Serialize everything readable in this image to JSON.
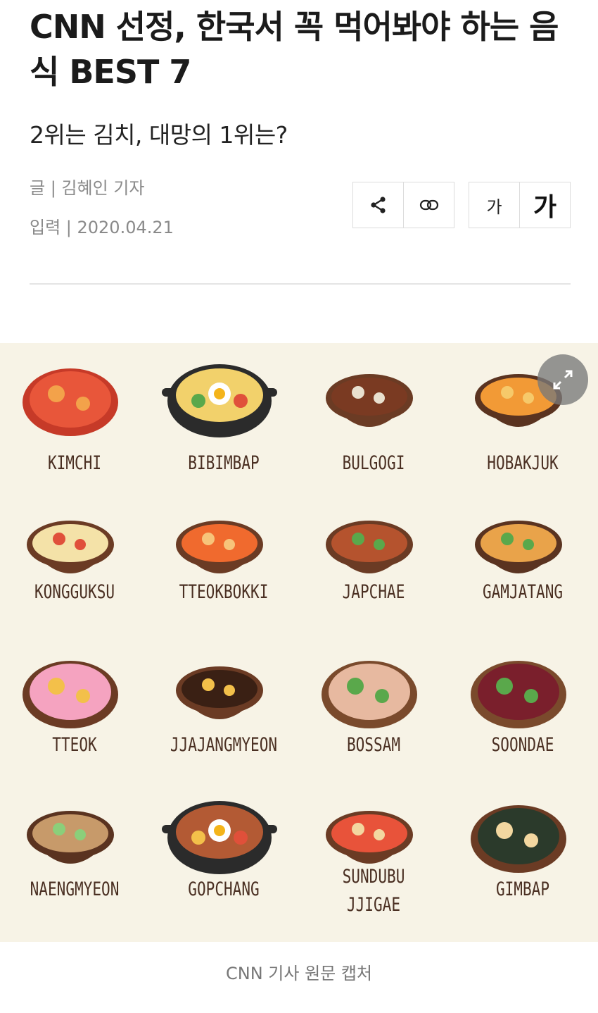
{
  "article": {
    "title": "CNN 선정, 한국서 꼭 먹어봐야 하는 음식 BEST 7",
    "subtitle": "2위는 김치, 대망의 1위는?",
    "author": "글 | 김혜인 기자",
    "date": "입력 | 2020.04.21"
  },
  "toolbar": {
    "share_icon": "share-icon",
    "link_icon": "link-icon",
    "font_small_label": "가",
    "font_large_label": "가"
  },
  "figure": {
    "expand_icon": "expand-icon",
    "caption": "CNN 기사 원문 캡처",
    "foods": [
      {
        "label": "KIMCHI",
        "line2": ""
      },
      {
        "label": "BIBIMBAP",
        "line2": ""
      },
      {
        "label": "BULGOGI",
        "line2": ""
      },
      {
        "label": "HOBAKJUK",
        "line2": ""
      },
      {
        "label": "KONGGUKSU",
        "line2": ""
      },
      {
        "label": "TTEOKBOKKI",
        "line2": ""
      },
      {
        "label": "JAPCHAE",
        "line2": ""
      },
      {
        "label": "GAMJATANG",
        "line2": ""
      },
      {
        "label": "TTEOK",
        "line2": ""
      },
      {
        "label": "JJAJANGMYEON",
        "line2": ""
      },
      {
        "label": "BOSSAM",
        "line2": ""
      },
      {
        "label": "SOONDAE",
        "line2": ""
      },
      {
        "label": "NAENGMYEON",
        "line2": ""
      },
      {
        "label": "GOPCHANG",
        "line2": ""
      },
      {
        "label": "SUNDUBU",
        "line2": "JJIGAE"
      },
      {
        "label": "GIMBAP",
        "line2": ""
      }
    ]
  }
}
